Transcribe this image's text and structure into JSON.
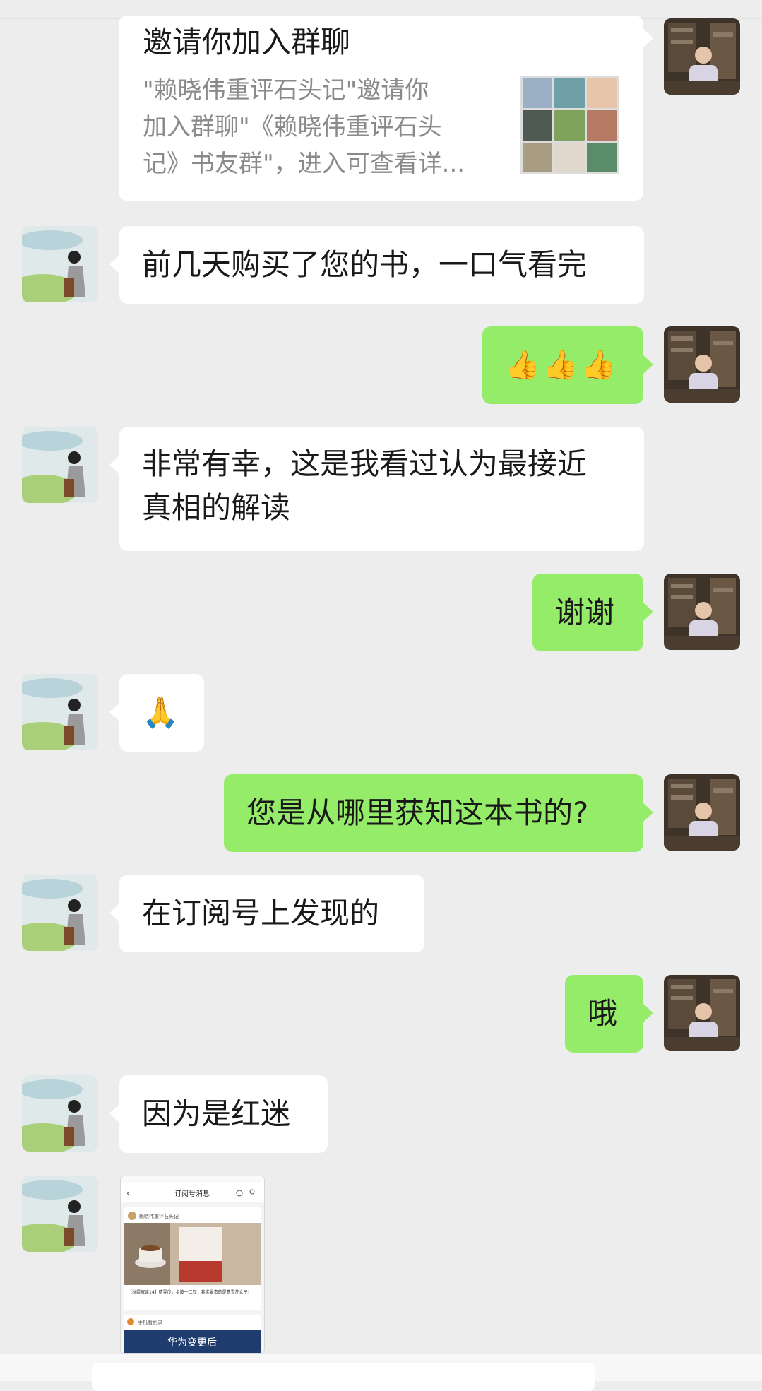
{
  "chat": {
    "messages": [
      {
        "side": "right",
        "type": "invite-card",
        "title": "邀请你加入群聊",
        "description": "\"赖晓伟重评石头记\"邀请你加入群聊\"《赖晓伟重评石头记》书友群\"，进入可查看详..."
      },
      {
        "side": "left",
        "type": "text",
        "text": "前几天购买了您的书，一口气看完"
      },
      {
        "side": "right",
        "type": "emoji",
        "text": "👍👍👍"
      },
      {
        "side": "left",
        "type": "text",
        "text": "非常有幸，这是我看过认为最接近真相的解读",
        "line1": "非常有幸，这是我看过认为最接近",
        "line2": "真相的解读"
      },
      {
        "side": "right",
        "type": "text",
        "text": "谢谢"
      },
      {
        "side": "left",
        "type": "emoji",
        "text": "🙏"
      },
      {
        "side": "right",
        "type": "text",
        "text": "您是从哪里获知这本书的?"
      },
      {
        "side": "left",
        "type": "text",
        "text": "在订阅号上发现的"
      },
      {
        "side": "right",
        "type": "text",
        "text": "哦"
      },
      {
        "side": "left",
        "type": "text",
        "text": "因为是红迷"
      },
      {
        "side": "left",
        "type": "image",
        "caption": "订阅号消息"
      }
    ]
  },
  "card": {
    "title": "邀请你加入群聊",
    "desc_line1": "\"赖晓伟重评石头记\"邀请你",
    "desc_line2": "加入群聊\"《赖晓伟重评石头",
    "desc_line3": "记》书友群\"，进入可查看详..."
  },
  "texts": {
    "m1": "前几天购买了您的书，一口气看完",
    "m2": "👍👍👍",
    "m3a": "非常有幸，这是我看过认为最接近",
    "m3b": "真相的解读",
    "m4": "谢谢",
    "m5": "🙏",
    "m6": "您是从哪里获知这本书的?",
    "m7": "在订阅号上发现的",
    "m8": "哦",
    "m9": "因为是红迷"
  },
  "thumbnail": {
    "header": "订阅号消息",
    "account": "赖晓伟重评石头记",
    "caption": "【秋霞解读14】晴雯传，金陵十二钗，其实最贵的是曹雪芹女子！",
    "second_account": "手机看剧录",
    "banner": "华为变更后"
  },
  "colors": {
    "background": "#ededed",
    "bubble_self": "#95ec69",
    "bubble_other": "#ffffff"
  }
}
